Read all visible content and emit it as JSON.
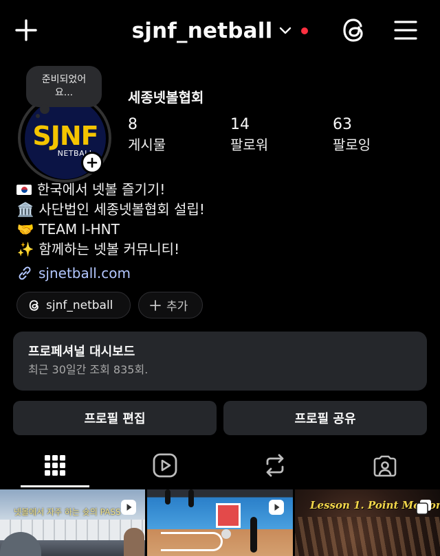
{
  "header": {
    "username": "sjnf_netball",
    "icons": [
      "plus-icon",
      "chevron-down-icon",
      "threads-icon",
      "menu-icon"
    ],
    "notification_dot_color": "#ff3040"
  },
  "note": {
    "text": "준비되었어요..."
  },
  "avatar": {
    "logo_text": "SJNF",
    "logo_sub": "NETBALL",
    "logo_color": "#f4c400",
    "bg_color": "#0b1445"
  },
  "profile": {
    "display_name": "세종넷볼협회",
    "stats": [
      {
        "value": "8",
        "label": "게시물"
      },
      {
        "value": "14",
        "label": "팔로워"
      },
      {
        "value": "63",
        "label": "팔로잉"
      }
    ]
  },
  "bio": {
    "lines": [
      {
        "emoji": "flag-korea",
        "text": "한국에서 넷볼 즐기기!"
      },
      {
        "emoji": "🏛️",
        "text": "사단법인 세종넷볼협회 설립!"
      },
      {
        "emoji": "🤝",
        "text": "TEAM I-HNT"
      },
      {
        "emoji": "✨",
        "text": "함께하는 넷볼 커뮤니티!"
      }
    ],
    "link": "sjnetball.com",
    "link_color": "#b3c7ff"
  },
  "chips": {
    "threads_label": "sjnf_netball",
    "add_label": "추가"
  },
  "dashboard": {
    "title": "프로페셔널 대시보드",
    "subtitle": "최근 30일간 조회 835회."
  },
  "actions": {
    "edit_label": "프로필 편집",
    "share_label": "프로필 공유"
  },
  "tabs": [
    "grid-icon",
    "reels-icon",
    "reposts-icon",
    "tagged-icon"
  ],
  "grid": {
    "thumbs": [
      {
        "caption": "넷볼에서 자주 하는 슛의 PASS",
        "type": "reel"
      },
      {
        "caption": "",
        "type": "reel"
      },
      {
        "caption": "Lesson 1. Point Motion",
        "type": "carousel"
      }
    ]
  }
}
